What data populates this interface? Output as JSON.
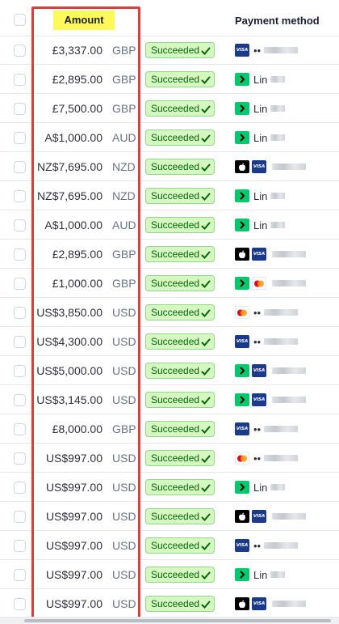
{
  "header": {
    "amount_label": "Amount",
    "payment_method_label": "Payment method"
  },
  "colors": {
    "highlight_border": "#e23b3b",
    "header_highlight": "#fff95a",
    "status_bg": "#d7f7c2",
    "status_text": "#006908",
    "link_green": "#00c96b",
    "visa_blue": "#1a3a8a"
  },
  "rows": [
    {
      "amount": "£3,337.00",
      "currency": "GBP",
      "status": "Succeeded",
      "method": [
        "visa-icon"
      ],
      "method_text": "••"
    },
    {
      "amount": "£2,895.00",
      "currency": "GBP",
      "status": "Succeeded",
      "method": [
        "link-icon"
      ],
      "method_text": "Lin"
    },
    {
      "amount": "£7,500.00",
      "currency": "GBP",
      "status": "Succeeded",
      "method": [
        "link-icon"
      ],
      "method_text": "Lin"
    },
    {
      "amount": "A$1,000.00",
      "currency": "AUD",
      "status": "Succeeded",
      "method": [
        "link-icon"
      ],
      "method_text": "Lin"
    },
    {
      "amount": "NZ$7,695.00",
      "currency": "NZD",
      "status": "Succeeded",
      "method": [
        "apple-pay-icon",
        "visa-icon"
      ],
      "method_text": ""
    },
    {
      "amount": "NZ$7,695.00",
      "currency": "NZD",
      "status": "Succeeded",
      "method": [
        "link-icon"
      ],
      "method_text": "Lin"
    },
    {
      "amount": "A$1,000.00",
      "currency": "AUD",
      "status": "Succeeded",
      "method": [
        "link-icon"
      ],
      "method_text": "Lin"
    },
    {
      "amount": "£2,895.00",
      "currency": "GBP",
      "status": "Succeeded",
      "method": [
        "apple-pay-icon",
        "visa-icon"
      ],
      "method_text": ""
    },
    {
      "amount": "£1,000.00",
      "currency": "GBP",
      "status": "Succeeded",
      "method": [
        "link-icon",
        "mastercard-icon"
      ],
      "method_text": ""
    },
    {
      "amount": "US$3,850.00",
      "currency": "USD",
      "status": "Succeeded",
      "method": [
        "mastercard-icon"
      ],
      "method_text": "••"
    },
    {
      "amount": "US$4,300.00",
      "currency": "USD",
      "status": "Succeeded",
      "method": [
        "visa-icon"
      ],
      "method_text": "••"
    },
    {
      "amount": "US$5,000.00",
      "currency": "USD",
      "status": "Succeeded",
      "method": [
        "link-icon",
        "visa-icon"
      ],
      "method_text": ""
    },
    {
      "amount": "US$3,145.00",
      "currency": "USD",
      "status": "Succeeded",
      "method": [
        "link-icon",
        "visa-icon"
      ],
      "method_text": ""
    },
    {
      "amount": "£8,000.00",
      "currency": "GBP",
      "status": "Succeeded",
      "method": [
        "visa-icon"
      ],
      "method_text": "••"
    },
    {
      "amount": "US$997.00",
      "currency": "USD",
      "status": "Succeeded",
      "method": [
        "mastercard-icon"
      ],
      "method_text": "••"
    },
    {
      "amount": "US$997.00",
      "currency": "USD",
      "status": "Succeeded",
      "method": [
        "link-icon"
      ],
      "method_text": "Lin"
    },
    {
      "amount": "US$997.00",
      "currency": "USD",
      "status": "Succeeded",
      "method": [
        "apple-pay-icon",
        "visa-icon"
      ],
      "method_text": ""
    },
    {
      "amount": "US$997.00",
      "currency": "USD",
      "status": "Succeeded",
      "method": [
        "visa-icon"
      ],
      "method_text": "••"
    },
    {
      "amount": "US$997.00",
      "currency": "USD",
      "status": "Succeeded",
      "method": [
        "link-icon"
      ],
      "method_text": "Lin"
    },
    {
      "amount": "US$997.00",
      "currency": "USD",
      "status": "Succeeded",
      "method": [
        "apple-pay-icon",
        "visa-icon"
      ],
      "method_text": ""
    }
  ]
}
